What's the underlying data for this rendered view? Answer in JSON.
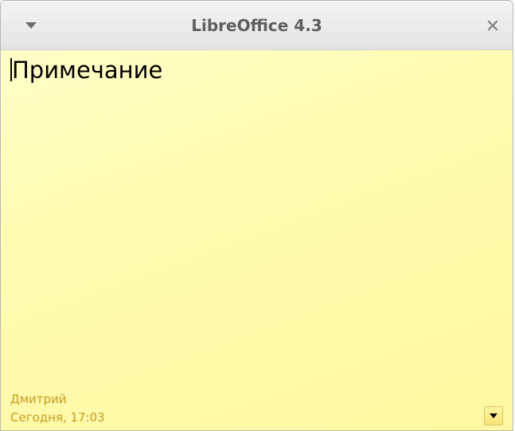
{
  "window": {
    "title": "LibreOffice 4.3",
    "menu_icon": "chevron-down-icon",
    "close_icon": "close-icon"
  },
  "note": {
    "text": "Примечание",
    "author": "Дмитрий",
    "timestamp": "Сегодня, 17:03",
    "options_icon": "dropdown-arrow-icon"
  },
  "colors": {
    "note_background": "#fffcb2",
    "meta_text": "#c89a20",
    "title_text": "#5e5e5e"
  }
}
